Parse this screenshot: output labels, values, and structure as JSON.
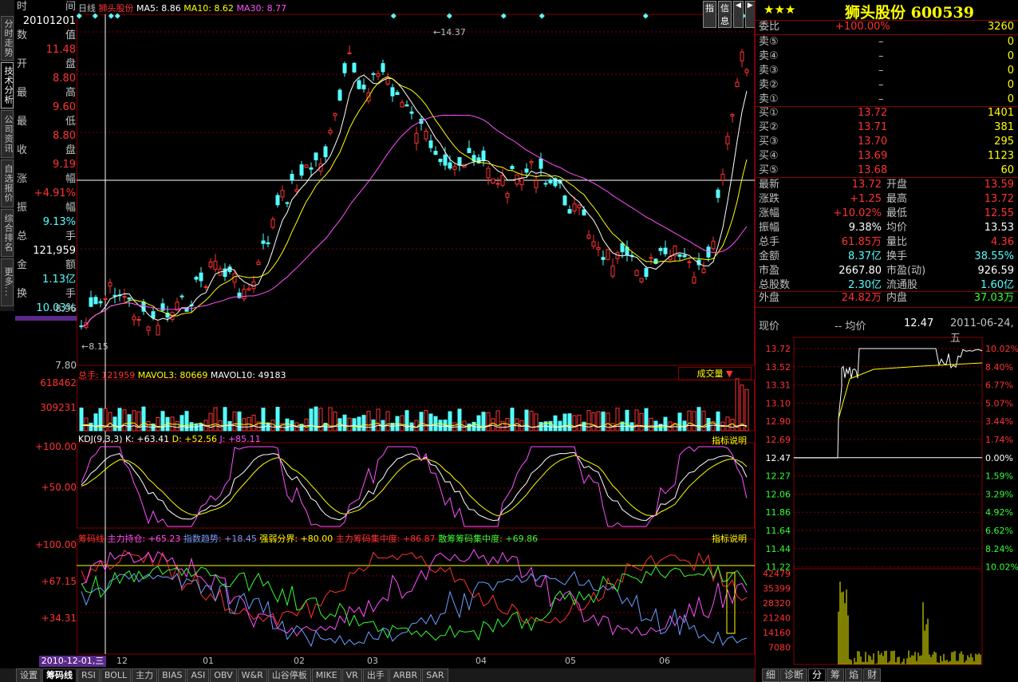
{
  "left_tabs": [
    "分时走势",
    "技术分析",
    "公司资讯",
    "自选报价",
    "综合排名",
    "更多..."
  ],
  "info": {
    "time_label": "时",
    "time_label2": "间",
    "date": "20101201",
    "val_label": "数",
    "val_label2": "值",
    "open_label": "开",
    "open_label2": "盘",
    "open": "8.80",
    "high_label": "最",
    "high_label2": "高",
    "high": "9.60",
    "low_label": "最",
    "low_label2": "低",
    "low": "8.80",
    "close_label": "收",
    "close_label2": "盘",
    "close": "9.19",
    "chg_label": "涨",
    "chg_label2": "幅",
    "chg": "+4.91%",
    "amp_label": "振",
    "amp_label2": "幅",
    "amp": "9.13%",
    "vol_label": "总",
    "vol_label2": "手",
    "vol": "121,959",
    "amt_label": "金",
    "amt_label2": "额",
    "amt": "1.13亿",
    "turn_label": "换",
    "turn_label2": "手",
    "turn": "10.03%",
    "value_top": "11.48"
  },
  "main": {
    "period": "日线",
    "stock_name": "狮头股份",
    "ma5": "MA5: 8.86",
    "ma10": "MA10: 8.62",
    "ma30": "MA30: 8.77",
    "price_labels": [
      "8.96",
      "7.80"
    ],
    "high_mark": "14.37",
    "low_mark": "8.15",
    "btn_zhi": "指",
    "btn_info": "信息"
  },
  "vol": {
    "title": "总手: 121959",
    "mavol3": "MAVOL3: 80669",
    "mavol10": "MAVOL10: 49183",
    "labels": [
      "618462",
      "309231"
    ],
    "dropdown": "成交量"
  },
  "kdj": {
    "title": "KDJ(9,3,3)",
    "k": "K: +63.41",
    "d": "D: +52.56",
    "j": "J: +85.11",
    "labels": [
      "+100.00",
      "+50.00"
    ],
    "explain": "指标说明"
  },
  "chip": {
    "title": "筹码线",
    "t1": "主力持仓: +65.23",
    "t2": "指数趋势: +18.45",
    "t3": "强弱分界: +80.00",
    "t4": "主力筹码集中度: +86.87",
    "t5": "散筹筹码集中度: +69.86",
    "labels": [
      "+100.00",
      "+67.15",
      "+34.31"
    ],
    "explain": "指标说明"
  },
  "xaxis": {
    "cursor_date": "2010-12-01,三",
    "months": [
      "12",
      "01",
      "02",
      "03",
      "04",
      "05",
      "06"
    ]
  },
  "bottom_tabs": [
    "设置",
    "筹码线",
    "RSI",
    "BOLL",
    "主力",
    "BIAS",
    "ASI",
    "OBV",
    "W&R",
    "山谷停板",
    "MIKE",
    "VR",
    "出手",
    "ARBR",
    "SAR"
  ],
  "quote": {
    "stars": "★★★",
    "title": "狮头股份 600539",
    "wb_label": "委比",
    "wb": "+100.00%",
    "wb_vol": "3260",
    "sells": [
      {
        "l": "卖⑤",
        "p": "–",
        "v": "0"
      },
      {
        "l": "卖④",
        "p": "–",
        "v": "0"
      },
      {
        "l": "卖③",
        "p": "–",
        "v": "0"
      },
      {
        "l": "卖②",
        "p": "–",
        "v": "0"
      },
      {
        "l": "卖①",
        "p": "–",
        "v": "0"
      }
    ],
    "buys": [
      {
        "l": "买①",
        "p": "13.72",
        "v": "1401"
      },
      {
        "l": "买②",
        "p": "13.71",
        "v": "381"
      },
      {
        "l": "买③",
        "p": "13.70",
        "v": "295"
      },
      {
        "l": "买④",
        "p": "13.69",
        "v": "1123"
      },
      {
        "l": "买⑤",
        "p": "13.68",
        "v": "60"
      }
    ],
    "stats": [
      {
        "l1": "最新",
        "v1": "13.72",
        "l2": "开盘",
        "v2": "13.59"
      },
      {
        "l1": "涨跌",
        "v1": "+1.25",
        "l2": "最高",
        "v2": "13.72"
      },
      {
        "l1": "涨幅",
        "v1": "+10.02%",
        "l2": "最低",
        "v2": "12.55"
      },
      {
        "l1": "振幅",
        "v1": "9.38%",
        "l2": "均价",
        "v2": "13.53"
      },
      {
        "l1": "总手",
        "v1": "61.85万",
        "l2": "量比",
        "v2": "4.36"
      },
      {
        "l1": "金额",
        "v1": "8.37亿",
        "l2": "换手",
        "v2": "38.55%"
      },
      {
        "l1": "市盈",
        "v1": "2667.80",
        "l2": "市盈(动)",
        "v2": "926.59"
      },
      {
        "l1": "总股数",
        "v1": "2.30亿",
        "l2": "流通股",
        "v2": "1.60亿"
      }
    ],
    "outer_label": "外盘",
    "outer": "24.82万",
    "inner_label": "内盘",
    "inner": "37.03万"
  },
  "intraday": {
    "price_label": "现价",
    "avg_label": "-- 均价",
    "price": "12.47",
    "date": "2011-06-24,五",
    "prices": [
      "13.72",
      "13.52",
      "13.31",
      "13.10",
      "12.90",
      "12.69",
      "12.47",
      "12.27",
      "12.06",
      "11.86",
      "11.64",
      "11.44",
      "11.22"
    ],
    "pcts": [
      "10.02%",
      "8.40%",
      "6.77%",
      "5.07%",
      "3.44%",
      "1.74%",
      "0.00%",
      "1.59%",
      "3.29%",
      "4.92%",
      "6.62%",
      "8.24%",
      "10.02%"
    ],
    "vols": [
      "42479",
      "35399",
      "28320",
      "21240",
      "14160",
      "7080"
    ]
  },
  "right_tabs": [
    "细",
    "诊断",
    "分",
    "筹",
    "焰",
    "财"
  ],
  "colors": {
    "up": "#ff3232",
    "down": "#54ffff",
    "grid": "#800000",
    "ma5": "#ffffff",
    "ma10": "#ffff00",
    "ma30": "#ff50ff"
  }
}
